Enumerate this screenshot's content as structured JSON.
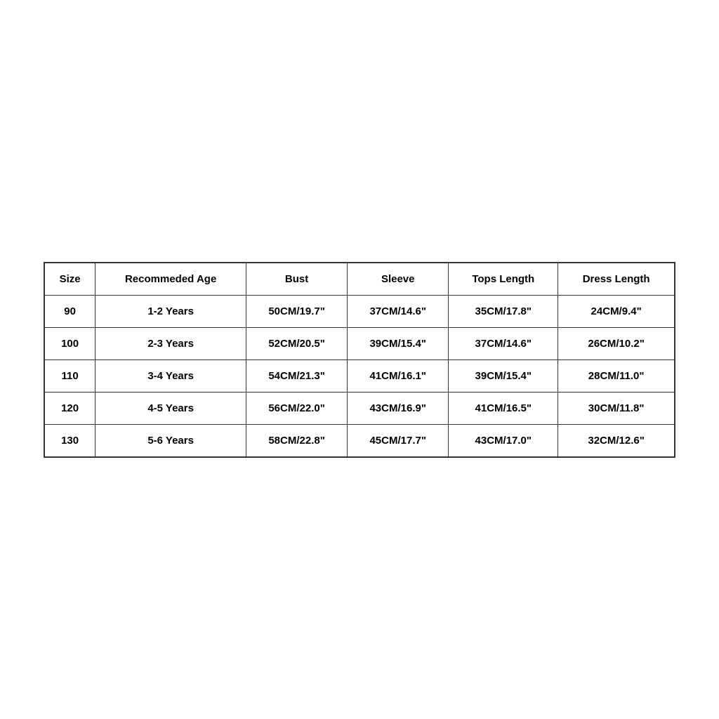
{
  "table": {
    "headers": [
      "Size",
      "Recommeded Age",
      "Bust",
      "Sleeve",
      "Tops Length",
      "Dress Length"
    ],
    "rows": [
      [
        "90",
        "1-2 Years",
        "50CM/19.7\"",
        "37CM/14.6\"",
        "35CM/17.8\"",
        "24CM/9.4\""
      ],
      [
        "100",
        "2-3 Years",
        "52CM/20.5\"",
        "39CM/15.4\"",
        "37CM/14.6\"",
        "26CM/10.2\""
      ],
      [
        "110",
        "3-4 Years",
        "54CM/21.3\"",
        "41CM/16.1\"",
        "39CM/15.4\"",
        "28CM/11.0\""
      ],
      [
        "120",
        "4-5 Years",
        "56CM/22.0\"",
        "43CM/16.9\"",
        "41CM/16.5\"",
        "30CM/11.8\""
      ],
      [
        "130",
        "5-6 Years",
        "58CM/22.8\"",
        "45CM/17.7\"",
        "43CM/17.0\"",
        "32CM/12.6\""
      ]
    ]
  }
}
